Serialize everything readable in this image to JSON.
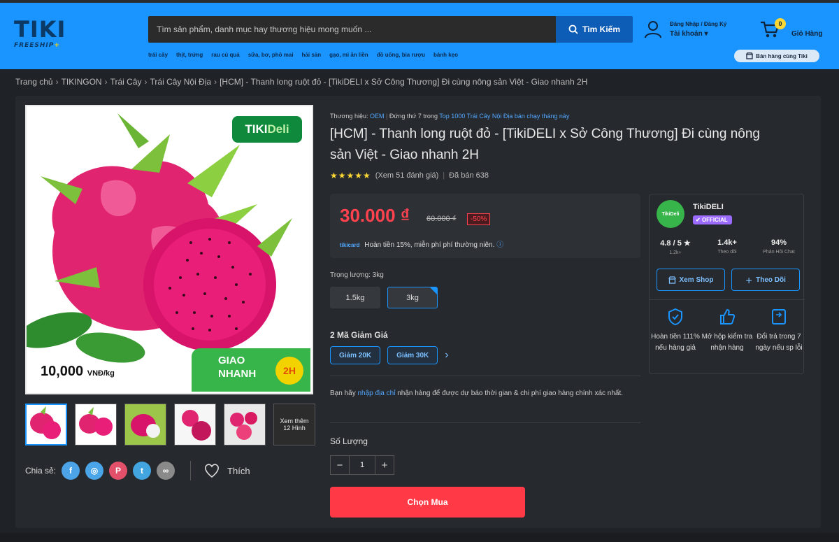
{
  "header": {
    "logo_main": "TIKI",
    "logo_sub_a": "FREESHIP",
    "logo_sub_b": "+",
    "search_placeholder": "Tìm sản phẩm, danh mục hay thương hiệu mong muốn ...",
    "search_button": "Tìm Kiếm",
    "categories": [
      "trái cây",
      "thịt, trứng",
      "rau củ quả",
      "sữa, bơ, phô mai",
      "hải sản",
      "gạo, mì ăn liền",
      "đồ uống, bia rượu",
      "bánh kẹo"
    ],
    "account_line1": "Đăng Nhập / Đăng Ký",
    "account_line2": "Tài khoản ▾",
    "cart_count": "0",
    "cart_label": "Giỏ Hàng",
    "sell_button": "Bán hàng cùng Tiki",
    "accent_color": "#1a94ff"
  },
  "breadcrumb": [
    "Trang chủ",
    "TIKINGON",
    "Trái Cây",
    "Trái Cây Nội Địa",
    "[HCM] - Thanh long ruột đỏ - [TikiDELI x Sở Công Thương] Đi cùng nông sản Việt - Giao nhanh 2H"
  ],
  "gallery": {
    "badge_a": "TIKI",
    "badge_b": "Deli",
    "price_tag": "10,000",
    "price_unit": "VNĐ/kg",
    "giao_line1": "GIAO",
    "giao_line2": "NHANH",
    "giao_badge": "2H",
    "more_label": "Xem thêm 12 Hình",
    "thumbnail_count": 6
  },
  "share": {
    "label": "Chia sẻ:",
    "like_label": "Thích"
  },
  "product": {
    "brand_prefix": "Thương hiệu:",
    "brand": "OEM",
    "rank_prefix": "Đứng thứ 7 trong",
    "rank_link": "Top 1000 Trái Cây Nội Địa bán chạy tháng này",
    "title": "[HCM] - Thanh long ruột đỏ - [TikiDELI x Sở Công Thương] Đi cùng nông sản Việt - Giao nhanh 2H",
    "rating_stars": 5,
    "reviews": "(Xem 51 đánh giá)",
    "sold": "Đã bán 638",
    "price": "30.000 ₫",
    "old_price": "60.000 ₫",
    "discount": "-50%",
    "cashback_tag": "tikicard",
    "cashback_text": "Hoàn tiền 15%, miễn phí phí thường niên.",
    "weight_label": "Trọng lượng: 3kg",
    "weights": [
      "1.5kg",
      "3kg"
    ],
    "coupon_title": "2 Mã Giảm Giá",
    "coupons": [
      "Giảm 20K",
      "Giảm 30K"
    ],
    "addr_before": "Bạn hãy ",
    "addr_link": "nhập địa chỉ",
    "addr_after": " nhận hàng để được dự báo thời gian & chi phí giao hàng chính xác nhất.",
    "qty_label": "Số Lượng",
    "qty_minus": "−",
    "qty_value": "1",
    "qty_plus": "+",
    "buy_button": "Chọn Mua",
    "buy_color": "#ff3945"
  },
  "seller": {
    "avatar_text": "TikiDeli",
    "name": "TikiDELI",
    "official": "OFFICIAL",
    "stats": [
      {
        "value": "4.8 / 5 ★",
        "label": "1.2k+"
      },
      {
        "value": "1.4k+",
        "label": "Theo dõi"
      },
      {
        "value": "94%",
        "label": "Phản Hồi Chat"
      }
    ],
    "view_shop": "Xem Shop",
    "follow": "Theo Dõi",
    "perks": [
      {
        "icon": "shield-check-icon",
        "text": "Hoàn tiền 111% nếu hàng giả"
      },
      {
        "icon": "thumbs-up-icon",
        "text": "Mở hộp kiểm tra nhận hàng"
      },
      {
        "icon": "return-box-icon",
        "text": "Đổi trả trong 7 ngày nếu sp lỗi"
      }
    ]
  }
}
